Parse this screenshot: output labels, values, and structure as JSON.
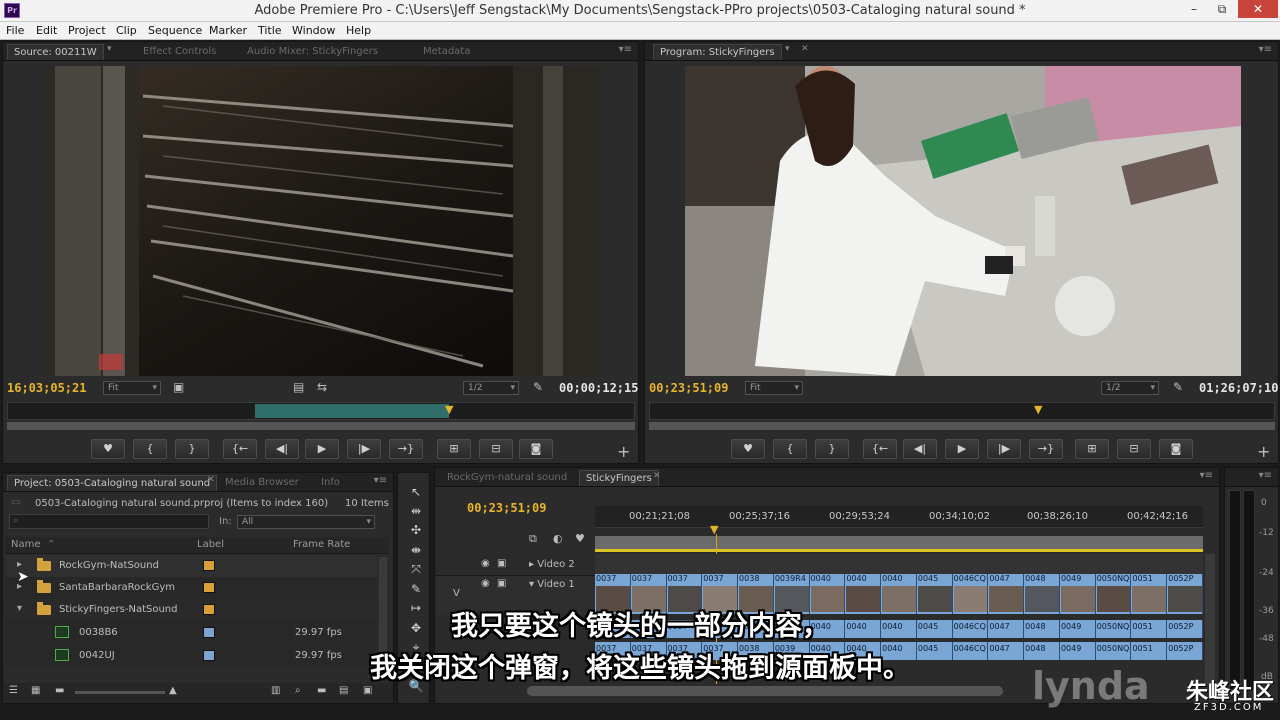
{
  "window": {
    "title": "Adobe Premiere Pro - C:\\Users\\Jeff Sengstack\\My Documents\\Sengstack-PPro projects\\0503-Cataloging natural sound *",
    "icon_text": "Pr",
    "minimize": "–",
    "maximize": "⧉",
    "close": "✕"
  },
  "menu": [
    "File",
    "Edit",
    "Project",
    "Clip",
    "Sequence",
    "Marker",
    "Title",
    "Window",
    "Help"
  ],
  "source_monitor": {
    "tabs": [
      "Source: 00211W",
      "Effect Controls",
      "Audio Mixer: StickyFingers",
      "Metadata"
    ],
    "timecode_in": "16;03;05;21",
    "fit": "Fit",
    "resolution": "1/2",
    "timecode_dur": "00;00;12;15"
  },
  "program_monitor": {
    "tab": "Program: StickyFingers",
    "timecode_in": "00;23;51;09",
    "fit": "Fit",
    "resolution": "1/2",
    "timecode_dur": "01;26;07;10"
  },
  "transport": {
    "marker": "♥",
    "mark_in": "{",
    "mark_out": "}",
    "go_in": "{←",
    "step_back": "◀|",
    "play": "▶",
    "step_fwd": "|▶",
    "go_out": "→}",
    "insert": "⊞",
    "overlay": "⊟",
    "export_frame": "◙",
    "add": "+"
  },
  "project": {
    "tabs": [
      "Project: 0503-Cataloging natural sound",
      "Media Browser",
      "Info"
    ],
    "filename": "0503-Cataloging natural sound.prproj (Items to index 160)",
    "item_count": "10 Items",
    "in_label": "In:",
    "in_value": "All",
    "columns": {
      "name": "Name",
      "label": "Label",
      "frame_rate": "Frame Rate"
    },
    "rows": [
      {
        "name": "RockGym-NatSound",
        "rate": "",
        "color": "#d9a03a",
        "kind": "folder",
        "expanded": false
      },
      {
        "name": "SantaBarbaraRockGym",
        "rate": "",
        "color": "#d9a03a",
        "kind": "folder",
        "expanded": false
      },
      {
        "name": "StickyFingers-NatSound",
        "rate": "",
        "color": "#d9a03a",
        "kind": "folder",
        "expanded": true
      },
      {
        "name": "0038B6",
        "rate": "29.97 fps",
        "color": "#7ea3cc",
        "kind": "clip",
        "expanded": false
      },
      {
        "name": "0042UJ",
        "rate": "29.97 fps",
        "color": "#7ea3cc",
        "kind": "clip",
        "expanded": false
      }
    ]
  },
  "tools": [
    "↖",
    "⇹",
    "✣",
    "⇼",
    "⤧",
    "✎",
    "↦",
    "✥",
    "⌖",
    "🔍"
  ],
  "timeline": {
    "tabs": [
      "RockGym-natural sound",
      "StickyFingers"
    ],
    "timecode": "00;23;51;09",
    "ruler": [
      "00;21;21;08",
      "00;25;37;16",
      "00;29;53;24",
      "00;34;10;02",
      "00;38;26;10",
      "00;42;42;16"
    ],
    "tracks": {
      "video2": "Video 2",
      "video1": "Video 1",
      "v_label": "V"
    },
    "video_clip_names": [
      "0037",
      "0037",
      "0037",
      "0037",
      "0038",
      "0039R4",
      "0040",
      "0040",
      "0040",
      "0045",
      "0046CQ [V]",
      "0047",
      "0048",
      "0049",
      "0050NQ",
      "0051",
      "0052P"
    ],
    "audio_clip_names": [
      "0037",
      "0037",
      "0037",
      "0037",
      "0038",
      "0039",
      "0040",
      "0040",
      "0040",
      "0045",
      "0046CQ [A]",
      "0047",
      "0048",
      "0049",
      "0050NQ",
      "0051",
      "0052P"
    ]
  },
  "audio_meter": {
    "scale": [
      "0",
      "-12",
      "-24",
      "-36",
      "-48",
      "dB"
    ]
  },
  "subtitles": [
    "我只要这个镜头的一部分内容，",
    "我关闭这个弹窗，将这些镜头拖到源面板中。"
  ],
  "watermark": {
    "brand": "lynda",
    "site": "朱峰社区",
    "url": "ZF3D.COM"
  },
  "colors": {
    "timecode_yellow": "#e8b42a",
    "clip_blue": "#7aa6d6",
    "label_orange": "#d9a03a",
    "label_blue": "#7ea3cc"
  }
}
